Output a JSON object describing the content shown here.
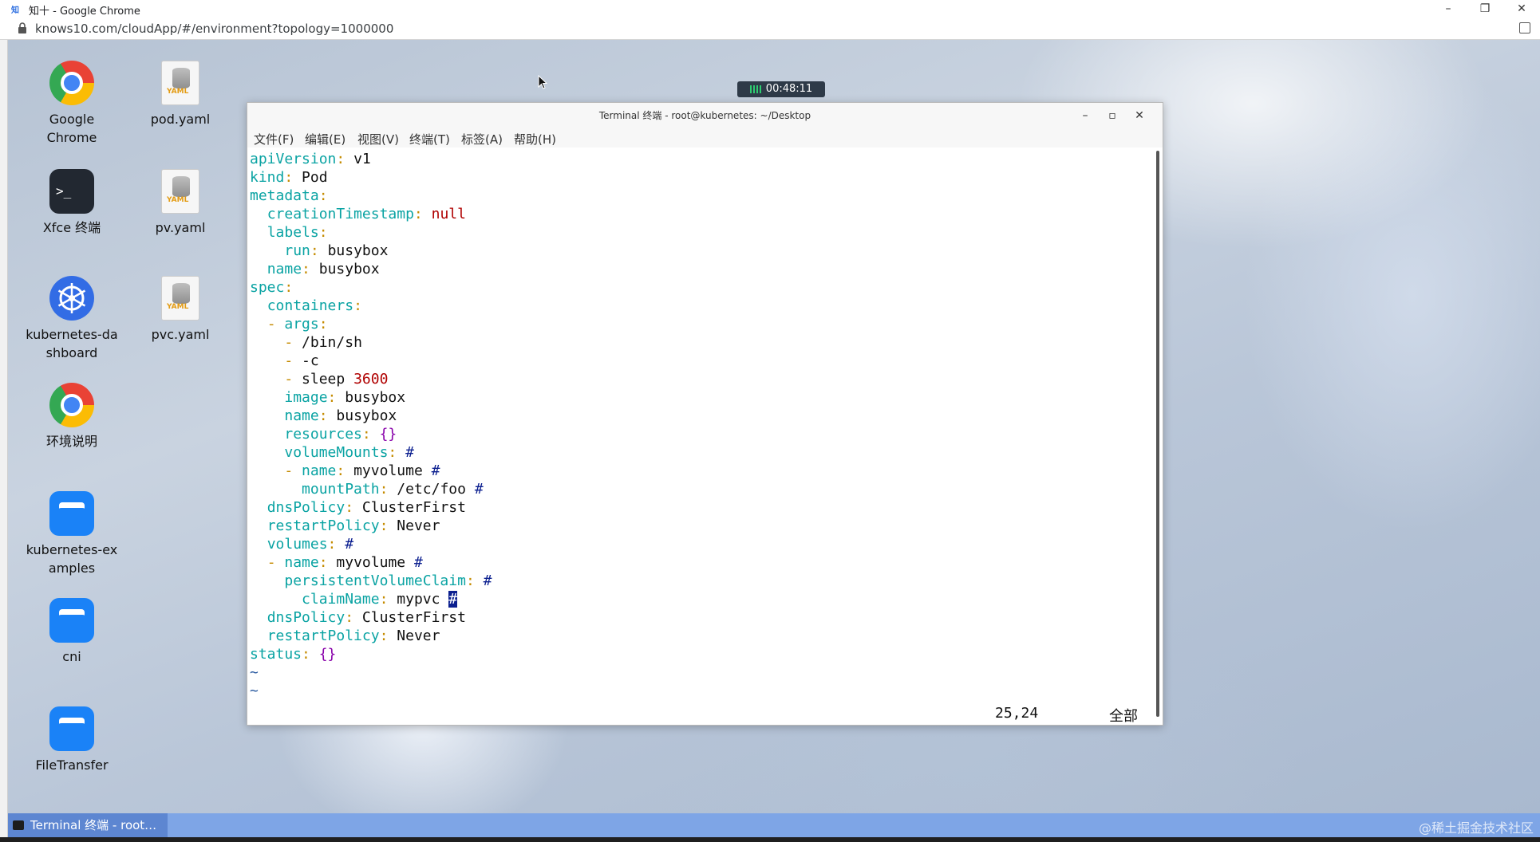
{
  "browser": {
    "tab_title": "知十 - Google Chrome",
    "favicon_text": "知十",
    "url": "knows10.com/cloudApp/#/environment?topology=1000000",
    "controls": {
      "minimize": "–",
      "restore": "❐",
      "close": "✕"
    }
  },
  "session": {
    "timer": "00:48:11"
  },
  "desktop_icons": [
    {
      "label": "Google Chrome",
      "icon": "chrome-icon"
    },
    {
      "label": "pod.yaml",
      "icon": "yaml-file-icon"
    },
    {
      "label": "Xfce 终端",
      "icon": "terminal-icon"
    },
    {
      "label": "pv.yaml",
      "icon": "yaml-file-icon"
    },
    {
      "label": "kubernetes-dashboard",
      "icon": "kubernetes-icon"
    },
    {
      "label": "pvc.yaml",
      "icon": "yaml-file-icon"
    },
    {
      "label": "环境说明",
      "icon": "chrome-icon"
    },
    {
      "label": "kubernetes-examples",
      "icon": "folder-icon"
    },
    {
      "label": "cni",
      "icon": "folder-icon"
    },
    {
      "label": "FileTransfer",
      "icon": "folder-icon"
    }
  ],
  "yaml_badge": "YAML",
  "terminal": {
    "title": "Terminal 终端 - root@kubernetes: ~/Desktop",
    "menu": [
      "文件(F)",
      "编辑(E)",
      "视图(V)",
      "终端(T)",
      "标签(A)",
      "帮助(H)"
    ],
    "status": {
      "position": "25,24",
      "scope": "全部"
    },
    "lines": [
      {
        "indent": "",
        "dash": "",
        "key": "apiVersion",
        "value": "v1",
        "hash": ""
      },
      {
        "indent": "",
        "dash": "",
        "key": "kind",
        "value": "Pod",
        "hash": ""
      },
      {
        "indent": "",
        "dash": "",
        "key": "metadata",
        "value": "",
        "hash": ""
      },
      {
        "indent": "  ",
        "dash": "",
        "key": "creationTimestamp",
        "value": "null",
        "hash": ""
      },
      {
        "indent": "  ",
        "dash": "",
        "key": "labels",
        "value": "",
        "hash": ""
      },
      {
        "indent": "    ",
        "dash": "",
        "key": "run",
        "value": "busybox",
        "hash": ""
      },
      {
        "indent": "  ",
        "dash": "",
        "key": "name",
        "value": "busybox",
        "hash": ""
      },
      {
        "indent": "",
        "dash": "",
        "key": "spec",
        "value": "",
        "hash": ""
      },
      {
        "indent": "  ",
        "dash": "",
        "key": "containers",
        "value": "",
        "hash": ""
      },
      {
        "indent": "  ",
        "dash": "- ",
        "key": "args",
        "value": "",
        "hash": ""
      },
      {
        "indent": "    ",
        "dash": "- ",
        "key": "",
        "value": "/bin/sh",
        "hash": ""
      },
      {
        "indent": "    ",
        "dash": "- ",
        "key": "",
        "value": "-c",
        "hash": ""
      },
      {
        "indent": "    ",
        "dash": "- ",
        "key": "",
        "value": "sleep",
        "num": "3600",
        "hash": ""
      },
      {
        "indent": "    ",
        "dash": "",
        "key": "image",
        "value": "busybox",
        "hash": ""
      },
      {
        "indent": "    ",
        "dash": "",
        "key": "name",
        "value": "busybox",
        "hash": ""
      },
      {
        "indent": "    ",
        "dash": "",
        "key": "resources",
        "value": "{}",
        "hash": ""
      },
      {
        "indent": "    ",
        "dash": "",
        "key": "volumeMounts",
        "value": "",
        "hash": "#"
      },
      {
        "indent": "    ",
        "dash": "- ",
        "key": "name",
        "value": "myvolume",
        "hash": "#"
      },
      {
        "indent": "      ",
        "dash": "",
        "key": "mountPath",
        "value": "/etc/foo",
        "hash": "#"
      },
      {
        "indent": "  ",
        "dash": "",
        "key": "dnsPolicy",
        "value": "ClusterFirst",
        "hash": ""
      },
      {
        "indent": "  ",
        "dash": "",
        "key": "restartPolicy",
        "value": "Never",
        "hash": ""
      },
      {
        "indent": "  ",
        "dash": "",
        "key": "volumes",
        "value": "",
        "hash": "#"
      },
      {
        "indent": "  ",
        "dash": "- ",
        "key": "name",
        "value": "myvolume",
        "hash": "#"
      },
      {
        "indent": "    ",
        "dash": "",
        "key": "persistentVolumeClaim",
        "value": "",
        "hash": "#"
      },
      {
        "indent": "      ",
        "dash": "",
        "key": "claimName",
        "value": "mypvc",
        "hash": "#",
        "cursor": true
      },
      {
        "indent": "  ",
        "dash": "",
        "key": "dnsPolicy",
        "value": "ClusterFirst",
        "hash": ""
      },
      {
        "indent": "  ",
        "dash": "",
        "key": "restartPolicy",
        "value": "Never",
        "hash": ""
      },
      {
        "indent": "",
        "dash": "",
        "key": "status",
        "value": "{}",
        "hash": ""
      },
      {
        "tilde": "~"
      },
      {
        "tilde": "~"
      }
    ]
  },
  "taskbar": {
    "task_label": "Terminal 终端 - root…",
    "watermark": "@稀土掘金技术社区"
  },
  "colors": {
    "key": "#0aa3a3",
    "punct": "#c58b00",
    "null": "#b00000",
    "brace": "#8800aa",
    "hash": "#0b1f8f"
  }
}
